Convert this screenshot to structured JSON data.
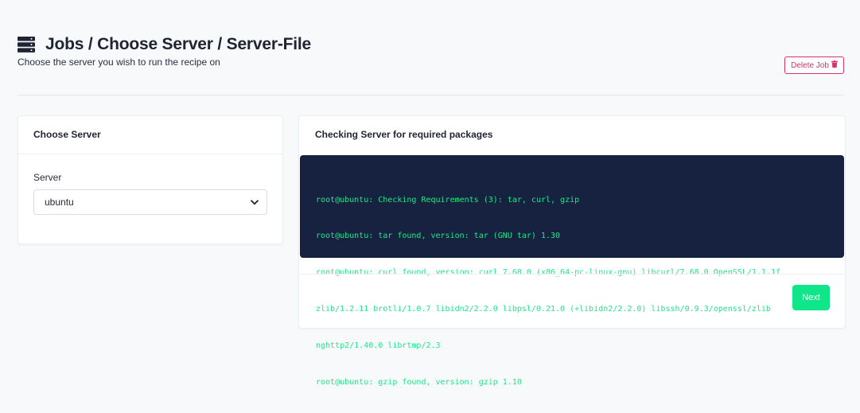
{
  "header": {
    "title": "Jobs / Choose Server / Server-File",
    "subtitle": "Choose the server you wish to run the recipe on",
    "icon": "server-icon"
  },
  "delete_button": {
    "label": "Delete Job",
    "icon": "trash-icon",
    "color": "#d6336c"
  },
  "choose_server": {
    "title": "Choose Server",
    "field_label": "Server",
    "selected": "ubuntu"
  },
  "check": {
    "title": "Checking Server for required packages",
    "log_lines": [
      "root@ubuntu: Checking Requirements (3): tar, curl, gzip",
      "root@ubuntu: tar found, version: tar (GNU tar) 1.30",
      "root@ubuntu: curl found, version: curl 7.68.0 (x86_64-pc-linux-gnu) libcurl/7.68.0 OpenSSL/1.1.1f",
      "zlib/1.2.11 brotli/1.0.7 libidn2/2.2.0 libpsl/0.21.0 (+libidn2/2.2.0) libssh/0.9.3/openssl/zlib",
      "nghttp2/1.40.0 librtmp/2.3",
      "root@ubuntu: gzip found, version: gzip 1.10"
    ],
    "next_label": "Next"
  },
  "colors": {
    "terminal_bg": "#16223f",
    "terminal_text": "#22e58a",
    "next_bg": "#0fe68a"
  }
}
